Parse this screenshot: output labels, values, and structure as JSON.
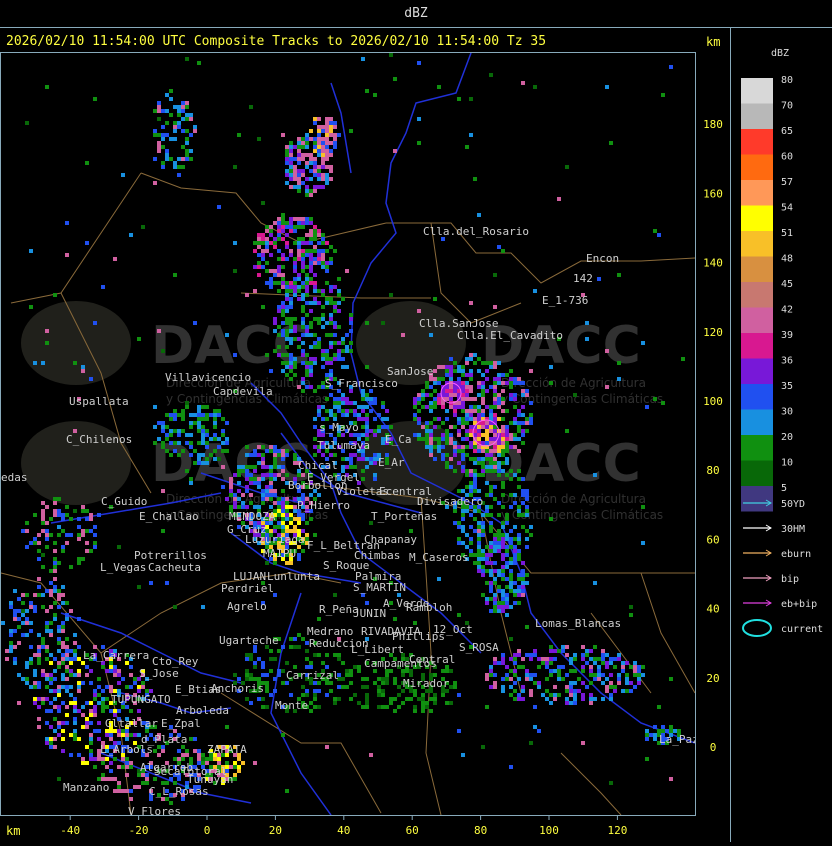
{
  "panel_title": "dBZ",
  "header_text": "2026/02/10 11:54:00 UTC Composite Tracks to 2026/02/10 11:54:00 Tz 35",
  "km_label": "km",
  "x_axis": {
    "unit": "km",
    "ticks": [
      "-40",
      "-20",
      "0",
      "20",
      "40",
      "60",
      "80",
      "100",
      "120"
    ],
    "values": [
      -40,
      -20,
      0,
      20,
      40,
      60,
      80,
      100,
      120
    ]
  },
  "y_axis": {
    "unit": "km",
    "ticks": [
      "180",
      "160",
      "140",
      "120",
      "100",
      "80",
      "60",
      "40",
      "20",
      "0"
    ],
    "values": [
      180,
      160,
      140,
      120,
      100,
      80,
      60,
      40,
      20,
      0
    ]
  },
  "watermark": {
    "brand": "DACC",
    "line1": "Dirección de Agricultura",
    "line2": "y Contingencias Climáticas"
  },
  "legend": {
    "title": "dBZ",
    "levels": [
      {
        "label": "80",
        "color": "#d8d8d8"
      },
      {
        "label": "70",
        "color": "#b8b8b8"
      },
      {
        "label": "65",
        "color": "#ff3a2a"
      },
      {
        "label": "60",
        "color": "#ff6a10"
      },
      {
        "label": "57",
        "color": "#ff9858"
      },
      {
        "label": "54",
        "color": "#ffff00"
      },
      {
        "label": "51",
        "color": "#f8c028"
      },
      {
        "label": "48",
        "color": "#d89040"
      },
      {
        "label": "45",
        "color": "#c87870"
      },
      {
        "label": "42",
        "color": "#d060a0"
      },
      {
        "label": "39",
        "color": "#d81890"
      },
      {
        "label": "36",
        "color": "#7818d8"
      },
      {
        "label": "35",
        "color": "#2050f0"
      },
      {
        "label": "30",
        "color": "#1890e0"
      },
      {
        "label": "20",
        "color": "#109010"
      },
      {
        "label": "10",
        "color": "#086808"
      },
      {
        "label": "5",
        "color": "#403880"
      }
    ],
    "tracks": [
      {
        "label": "50YD",
        "color": "#40d0e0"
      },
      {
        "label": "30HM",
        "color": "#ffffff"
      },
      {
        "label": "eburn",
        "color": "#f0b060"
      },
      {
        "label": "bip",
        "color": "#f0a0c0"
      },
      {
        "label": "eb+bip",
        "color": "#e040e0"
      }
    ],
    "current_label": "current",
    "current_color": "#20e0e0"
  },
  "places": [
    {
      "name": "Clla.del_Rosario"
    },
    {
      "name": "Encon"
    },
    {
      "name": "E_1-736"
    },
    {
      "name": "142"
    },
    {
      "name": "Clla.SanJose"
    },
    {
      "name": "Clla.El_Cavadito"
    },
    {
      "name": "SanJose"
    },
    {
      "name": "Villavicencio"
    },
    {
      "name": "Uspallata"
    },
    {
      "name": "Capdevila"
    },
    {
      "name": "S_Francisco"
    },
    {
      "name": "C_Chilenos"
    },
    {
      "name": "edas"
    },
    {
      "name": "s_Mayo"
    },
    {
      "name": "Tulumaya"
    },
    {
      "name": "E_Ca"
    },
    {
      "name": "E_Ar"
    },
    {
      "name": "Chical"
    },
    {
      "name": "E_Vergel"
    },
    {
      "name": "Violetas"
    },
    {
      "name": "Ecentral"
    },
    {
      "name": "Divisadero"
    },
    {
      "name": "Borbollon"
    },
    {
      "name": "C_Guido"
    },
    {
      "name": "P_Hierro"
    },
    {
      "name": "E_Challao"
    },
    {
      "name": "MENDOZA"
    },
    {
      "name": "T_Porteñas"
    },
    {
      "name": "G_Cruz"
    },
    {
      "name": "Chapanay"
    },
    {
      "name": "Luzuriaga"
    },
    {
      "name": "F_L_Beltran"
    },
    {
      "name": "M_Caseros"
    },
    {
      "name": "MAIPU"
    },
    {
      "name": "Chimbas"
    },
    {
      "name": "Potrerillos"
    },
    {
      "name": "S_Roque"
    },
    {
      "name": "L_Vegas"
    },
    {
      "name": "Cacheuta"
    },
    {
      "name": "LUJAN"
    },
    {
      "name": "Lunlunta"
    },
    {
      "name": "Palmira"
    },
    {
      "name": "Perdriel"
    },
    {
      "name": "S_MARTIN"
    },
    {
      "name": "A_Verde"
    },
    {
      "name": "Rambloh"
    },
    {
      "name": "Agrelo"
    },
    {
      "name": "R_Peña"
    },
    {
      "name": "JUNIN"
    },
    {
      "name": "Ugarteche"
    },
    {
      "name": "Medrano"
    },
    {
      "name": "RIVADAVIA"
    },
    {
      "name": "Phillips"
    },
    {
      "name": "12_Oct"
    },
    {
      "name": "Lomas_Blancas"
    },
    {
      "name": "Reduccion"
    },
    {
      "name": "L_Libert"
    },
    {
      "name": "S_ROSA"
    },
    {
      "name": "La_Carrera"
    },
    {
      "name": "Campamentos"
    },
    {
      "name": "Central"
    },
    {
      "name": "Cto_Rey"
    },
    {
      "name": "S_Jose"
    },
    {
      "name": "Carrizal"
    },
    {
      "name": "Anchoris"
    },
    {
      "name": "E_Btias"
    },
    {
      "name": "TUPUNGATO"
    },
    {
      "name": "Mirador"
    },
    {
      "name": "La_Paz"
    },
    {
      "name": "Arboleda"
    },
    {
      "name": "Gltallar"
    },
    {
      "name": "E_Zpal"
    },
    {
      "name": "d_Plata"
    },
    {
      "name": "L_Arbols"
    },
    {
      "name": "Algarrob"
    },
    {
      "name": "Seca"
    },
    {
      "name": "Totoral"
    },
    {
      "name": "ZAPATA"
    },
    {
      "name": "Manzano"
    },
    {
      "name": "C_L_Rosas"
    },
    {
      "name": "V_Flores"
    },
    {
      "name": "Tunuyan"
    },
    {
      "name": "Monte"
    }
  ]
}
